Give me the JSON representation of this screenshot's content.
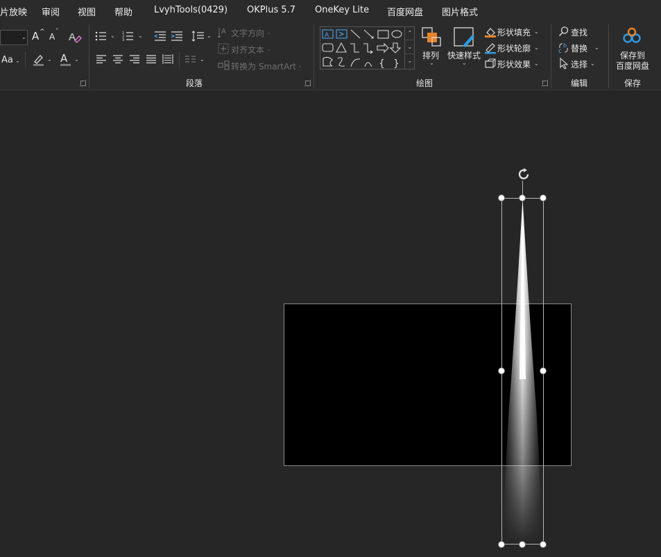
{
  "menu_tabs": [
    "片放映",
    "审阅",
    "视图",
    "帮助",
    "LvyhTools(0429)",
    "OKPlus 5.7",
    "OneKey Lite",
    "百度网盘",
    "图片格式"
  ],
  "font_group": {
    "grow_font": "A",
    "shrink_font": "A",
    "change_case": "Aa",
    "font_color_letter": "A"
  },
  "paragraph": {
    "group_label": "段落",
    "text_direction": "文字方向",
    "align_text": "对齐文本",
    "convert_smartart": "转换为 SmartArt"
  },
  "drawing": {
    "group_label": "绘图",
    "arrange": "排列",
    "quick_styles": "快速样式",
    "shape_fill": "形状填充",
    "shape_outline": "形状轮廓",
    "shape_effects": "形状效果"
  },
  "editing": {
    "group_label": "编辑",
    "find": "查找",
    "replace": "替换",
    "select": "选择"
  },
  "save": {
    "group_label": "保存",
    "save_to_line1": "保存到",
    "save_to_line2": "百度网盘"
  },
  "colors": {
    "ribbon_bg": "#2b2b2b",
    "canvas_bg": "#262626",
    "accent_orange": "#e8832a",
    "accent_blue": "#2f9be6"
  }
}
